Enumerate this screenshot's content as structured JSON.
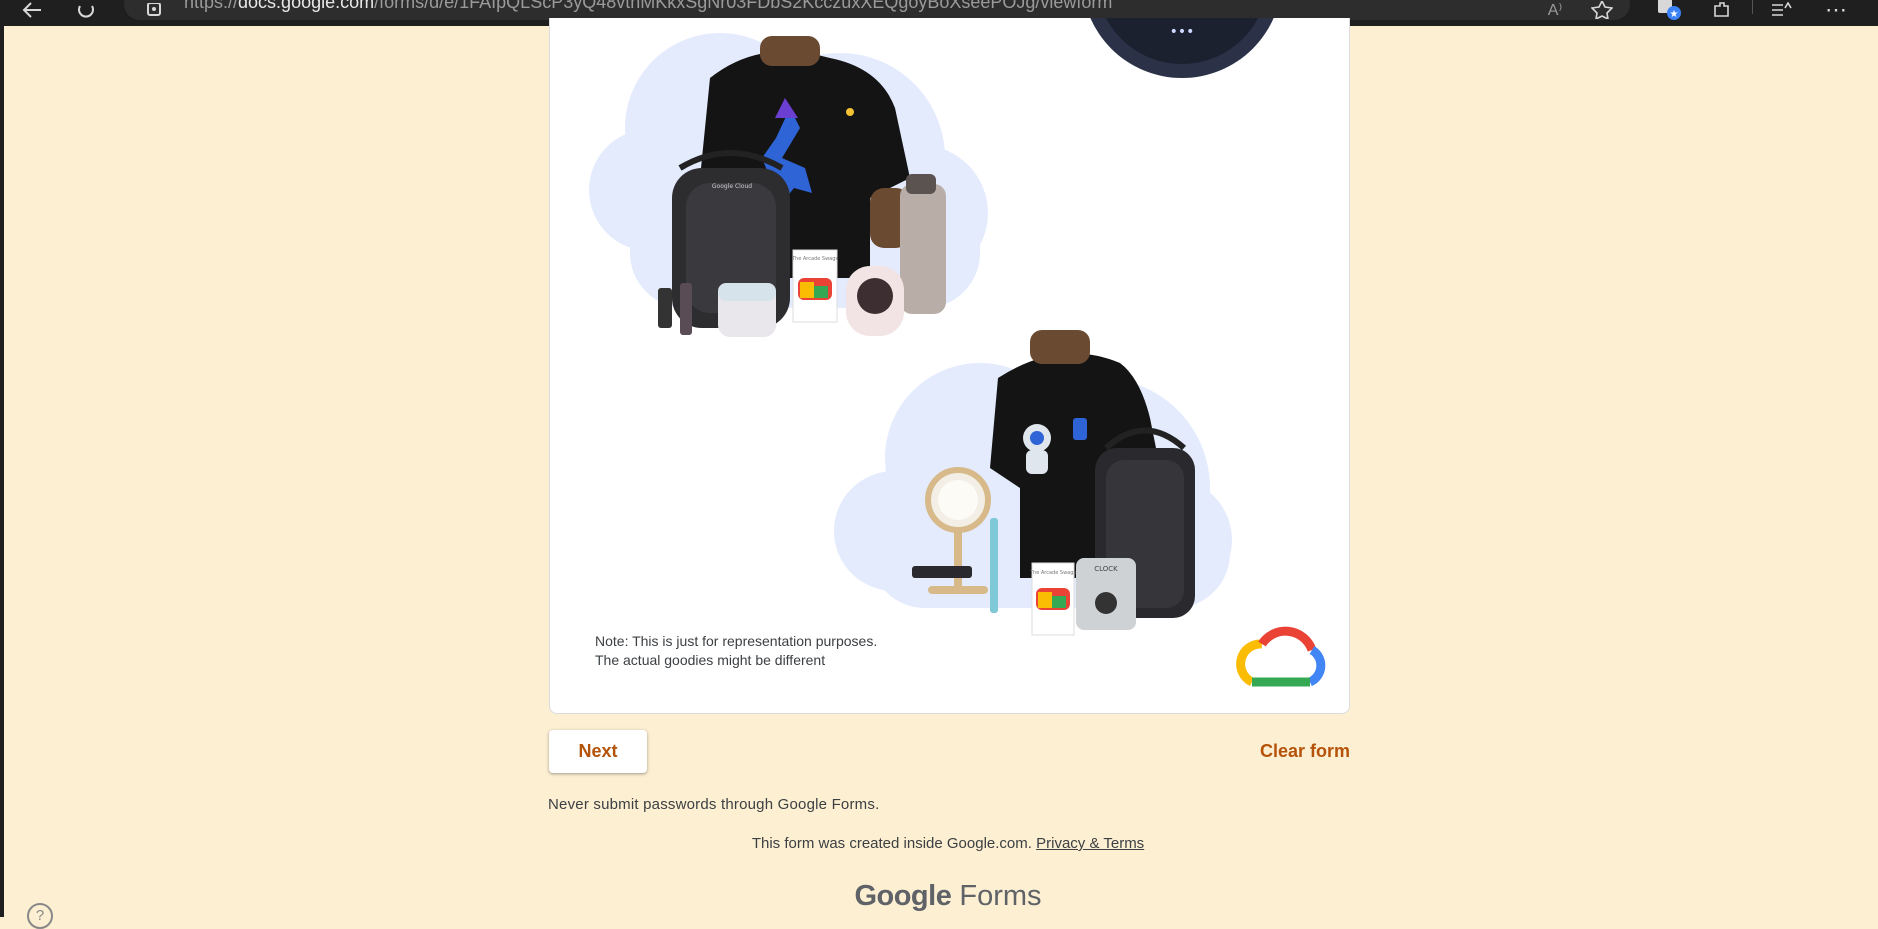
{
  "browser": {
    "url_prefix": "https://",
    "url_host": "docs.google.com",
    "url_path": "/forms/d/e/1FAIpQLScP3yQ48vthMKkxSgNr03FDbS2KcczuxXEQgoyBoXseePOJg/viewform",
    "read_aloud_label": "A⁾"
  },
  "card": {
    "note_line1": "Note: This is just for representation purposes.",
    "note_line2": "The actual goodies might be different",
    "image1_box": {
      "label1": "Google Cloud",
      "label2": "The Arcade Swags"
    },
    "image2_box": {
      "label1": "Google Cloud",
      "label2": "The Arcade Swags",
      "clock": "CLOCK"
    }
  },
  "actions": {
    "next_label": "Next",
    "clear_label": "Clear form"
  },
  "footer": {
    "warning": "Never submit passwords through Google Forms.",
    "created_text": "This form was created inside Google.com.",
    "privacy_link": "Privacy & Terms",
    "brand_google": "Google",
    "brand_forms": "Forms"
  },
  "help_glyph": "?",
  "colors": {
    "page_background": "#fdefd2",
    "accent": "#b45309",
    "cloud_blue": "#e3ebfd"
  }
}
